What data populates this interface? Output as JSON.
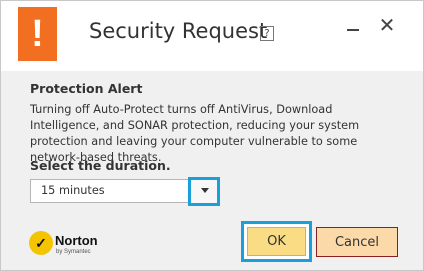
{
  "window": {
    "title": "Security Request",
    "alert_glyph": "!",
    "help_glyph": "?",
    "close_glyph": "✕"
  },
  "alert": {
    "heading": "Protection Alert",
    "message": "Turning off Auto-Protect turns off AntiVirus, Download Intelligence, and SONAR protection, reducing your system protection and leaving your computer vulnerable to some network-based threats."
  },
  "duration": {
    "label": "Select the duration.",
    "selected": "15 minutes"
  },
  "brand": {
    "name": "Norton",
    "tagline": "by Symantec",
    "check_glyph": "✓"
  },
  "buttons": {
    "ok": "OK",
    "cancel": "Cancel"
  },
  "colors": {
    "alert_orange": "#f26f21",
    "focus_blue": "#1a9fd9",
    "ok_fill": "#f9dc84",
    "cancel_fill": "#fbd9a8"
  }
}
